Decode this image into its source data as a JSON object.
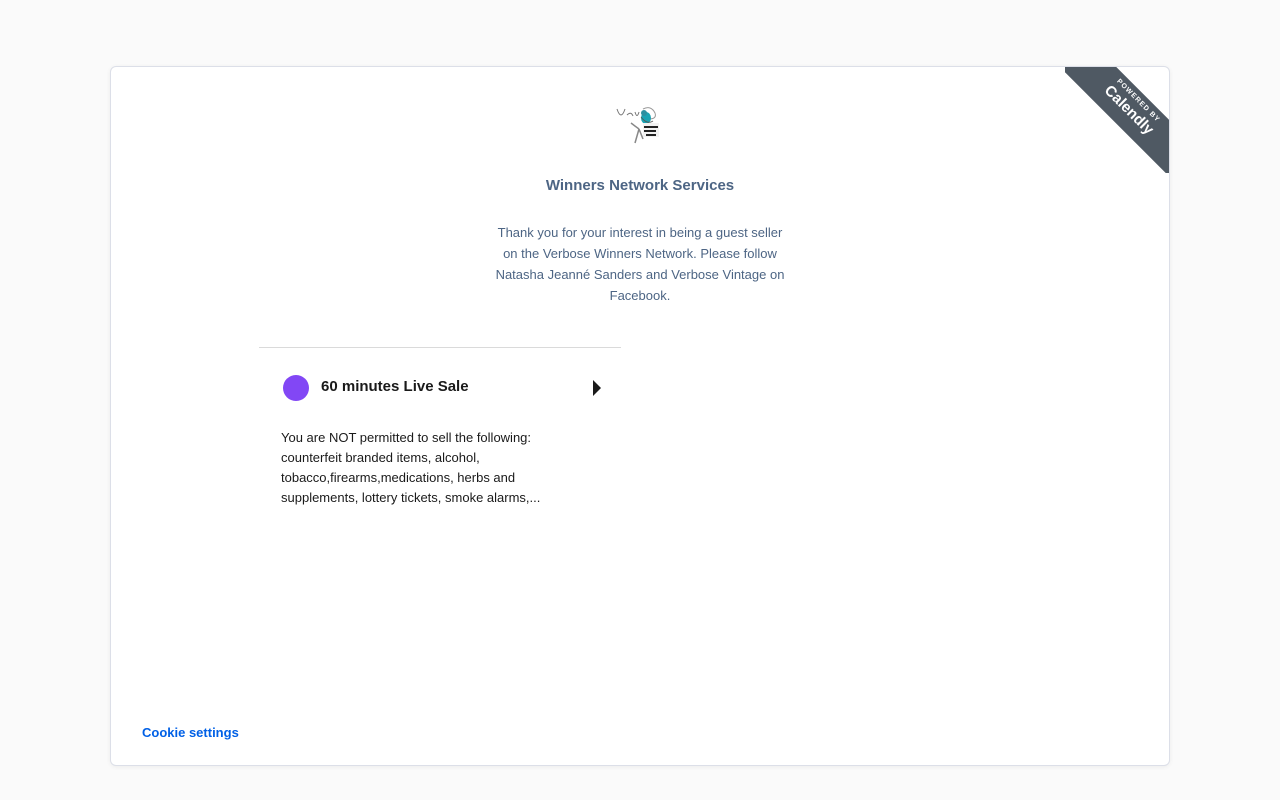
{
  "ribbon": {
    "powered_by": "POWERED BY",
    "brand": "Calendly"
  },
  "header": {
    "logo_icon": "verbose-logo-icon",
    "org_name": "Winners Network Services",
    "description": "Thank you for your interest in being a guest seller on the Verbose Winners Network. Please follow Natasha Jeanné Sanders and Verbose Vintage on Facebook."
  },
  "event": {
    "color": "#8247f5",
    "title": "60 minutes Live Sale",
    "description": "You are NOT permitted to sell the following: counterfeit branded items, alcohol, tobacco,firearms,medications, herbs and supplements, lottery tickets, smoke alarms,..."
  },
  "footer": {
    "cookie_settings": "Cookie settings"
  },
  "colors": {
    "accent_link": "#0060e6",
    "heading": "#4d6584",
    "ribbon": "#4f5963"
  }
}
